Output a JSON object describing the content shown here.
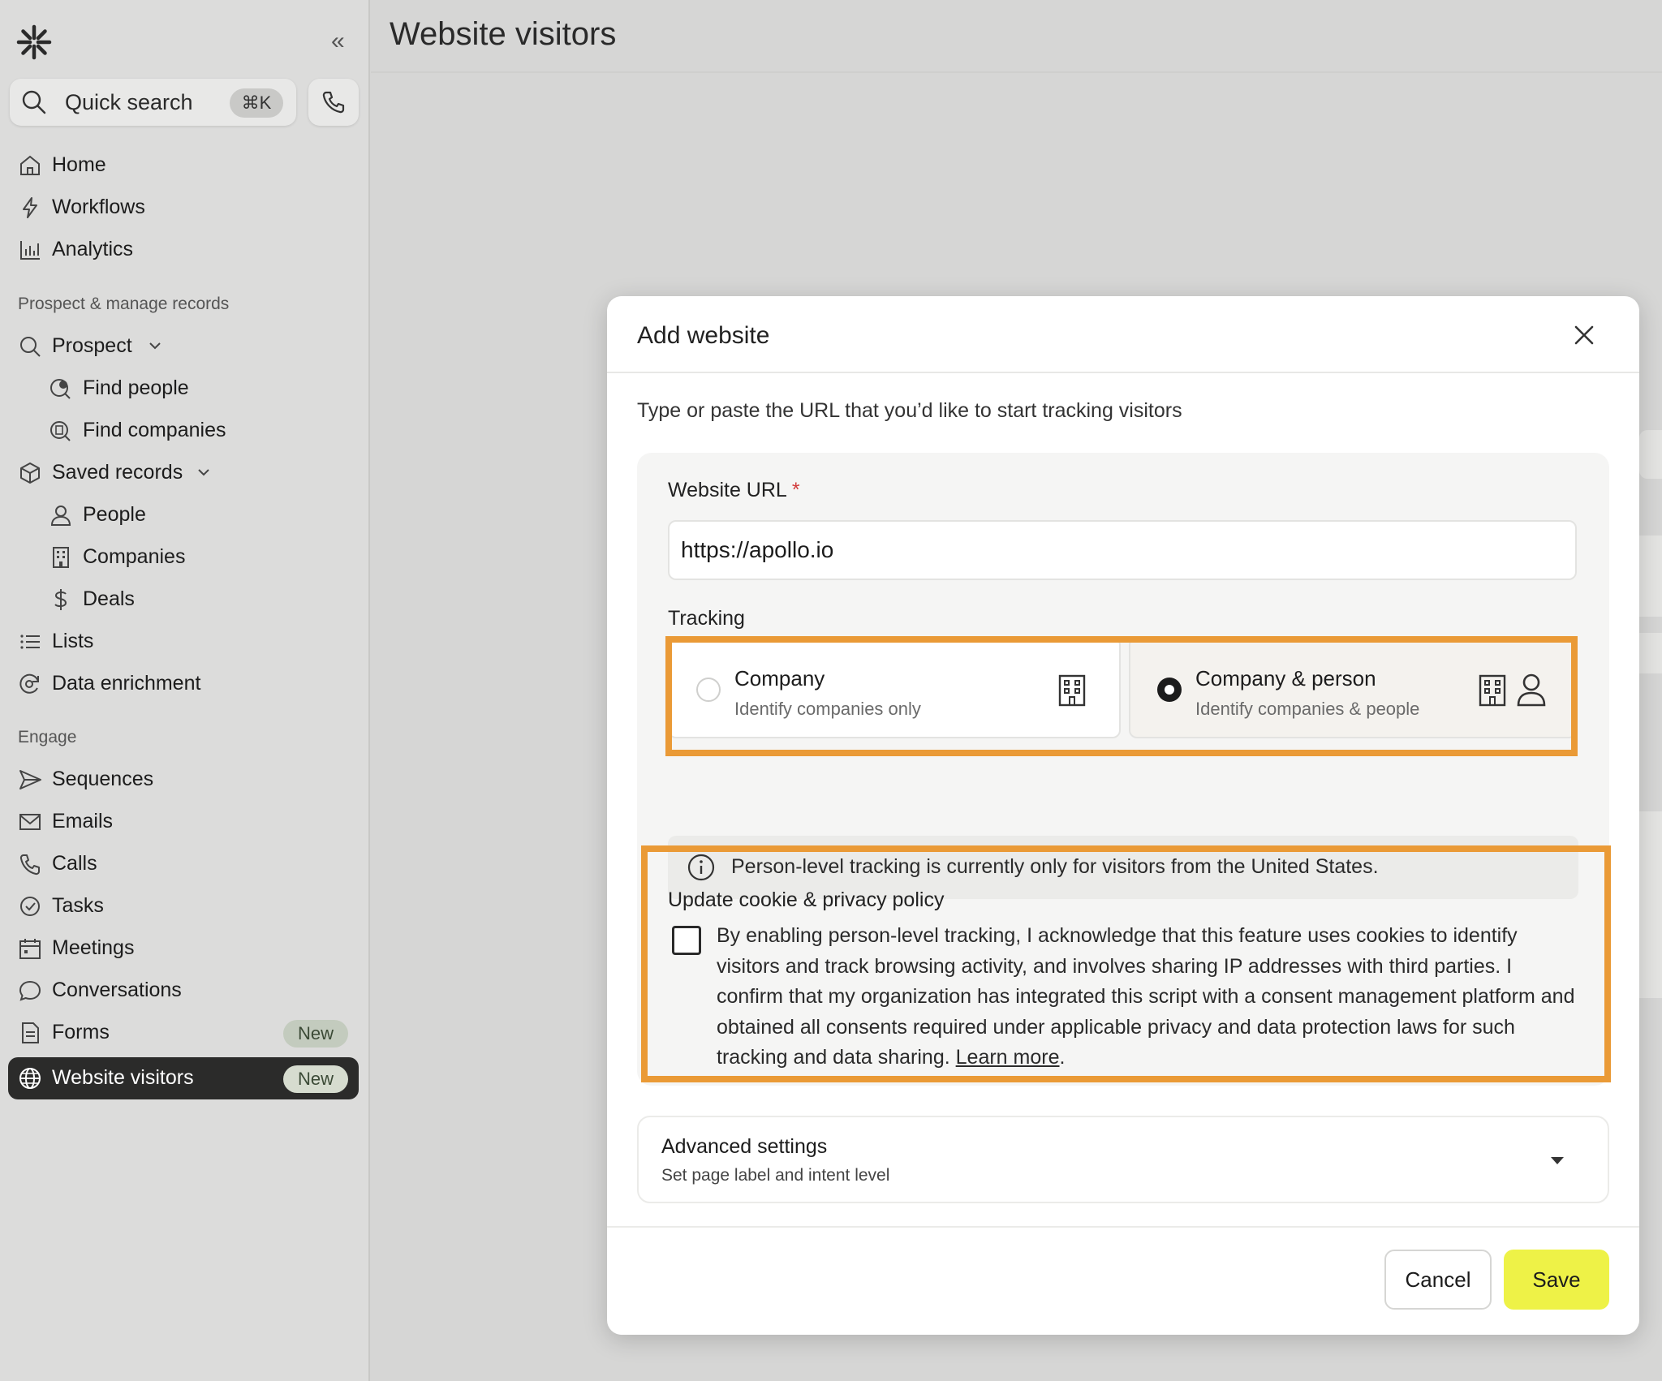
{
  "sidebar": {
    "collapse_label": "«",
    "search": {
      "label": "Quick search",
      "shortcut": "⌘K"
    },
    "items_top": [
      {
        "label": "Home",
        "icon": "home-icon"
      },
      {
        "label": "Workflows",
        "icon": "bolt-icon"
      },
      {
        "label": "Analytics",
        "icon": "bar-chart-icon"
      }
    ],
    "section_prospect": "Prospect & manage records",
    "prospect": {
      "label": "Prospect",
      "find_people": "Find people",
      "find_companies": "Find companies"
    },
    "saved_records": {
      "label": "Saved records",
      "people": "People",
      "companies": "Companies",
      "deals": "Deals"
    },
    "lists": "Lists",
    "data_enrichment": "Data enrichment",
    "section_engage": "Engage",
    "engage": {
      "sequences": "Sequences",
      "emails": "Emails",
      "calls": "Calls",
      "tasks": "Tasks",
      "meetings": "Meetings",
      "conversations": "Conversations",
      "forms": "Forms",
      "forms_badge": "New",
      "website_visitors": "Website visitors",
      "website_visitors_badge": "New"
    }
  },
  "main": {
    "title": "Website visitors"
  },
  "modal": {
    "title": "Add website",
    "description": "Type or paste the URL that you’d like to start tracking visitors",
    "url_label": "Website URL",
    "url_required_mark": "*",
    "url_value": "https://apollo.io",
    "tracking_label": "Tracking",
    "options": [
      {
        "title": "Company",
        "subtitle": "Identify companies only",
        "selected": false
      },
      {
        "title": "Company & person",
        "subtitle": "Identify companies & people",
        "selected": true
      }
    ],
    "info_text": "Person-level tracking is currently only for visitors from the United States.",
    "policy_title": "Update cookie & privacy policy",
    "policy_text": "By enabling person-level tracking, I acknowledge that this feature uses cookies to identify visitors and track browsing activity, and involves sharing IP addresses with third parties. I confirm that my organization has integrated this script with a consent management platform and obtained all consents required under applicable privacy and data protection laws for such tracking and data sharing.",
    "policy_link": "Learn more",
    "policy_end": ".",
    "advanced_title": "Advanced settings",
    "advanced_subtitle": "Set page label and intent level",
    "cancel_label": "Cancel",
    "save_label": "Save"
  },
  "colors": {
    "highlight": "#ea9a36",
    "save_button": "#eef247",
    "active_nav": "#2b2b2a"
  }
}
